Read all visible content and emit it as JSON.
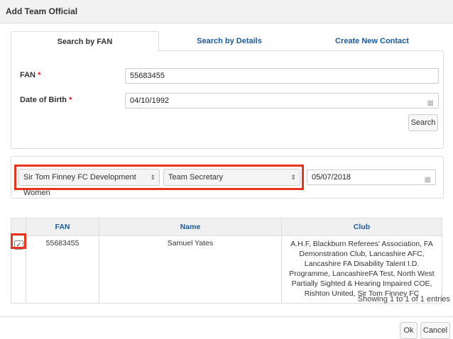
{
  "dialog": {
    "title": "Add Team Official"
  },
  "tabs": [
    {
      "label": "Search by FAN"
    },
    {
      "label": "Search by Details"
    },
    {
      "label": "Create New Contact"
    }
  ],
  "form": {
    "fan_label": "FAN",
    "fan_required": "*",
    "fan_value": "55683455",
    "dob_label": "Date of Birth",
    "dob_required": "*",
    "dob_value": "04/10/1992",
    "calendar_icon": "calendar-icon",
    "search_label": "Search"
  },
  "selection": {
    "team": "Sir Tom Finney FC Development Women",
    "role": "Team Secretary",
    "date": "05/07/2018"
  },
  "table": {
    "headers": [
      "FAN",
      "Name",
      "Club"
    ],
    "rows": [
      {
        "checked": "✓",
        "fan": "55683455",
        "name": "Samuel Yates",
        "club": "A.H.F, Blackburn Referees' Association, FA Demonstration Club, Lancashire AFC, Lancashire FA Disability Talent I.D. Programme, LancashireFA Test, North West Partially Sighted & Hearing Impaired COE, Rishton United, Sir Tom Finney FC"
      }
    ],
    "info": "Showing 1 to 1 of 1 entries"
  },
  "footer": {
    "ok_label": "Ok",
    "cancel_label": "Cancel"
  },
  "colors": {
    "accent": "#1a5a9e",
    "highlight": "#e8341c",
    "required": "#d9141c"
  }
}
